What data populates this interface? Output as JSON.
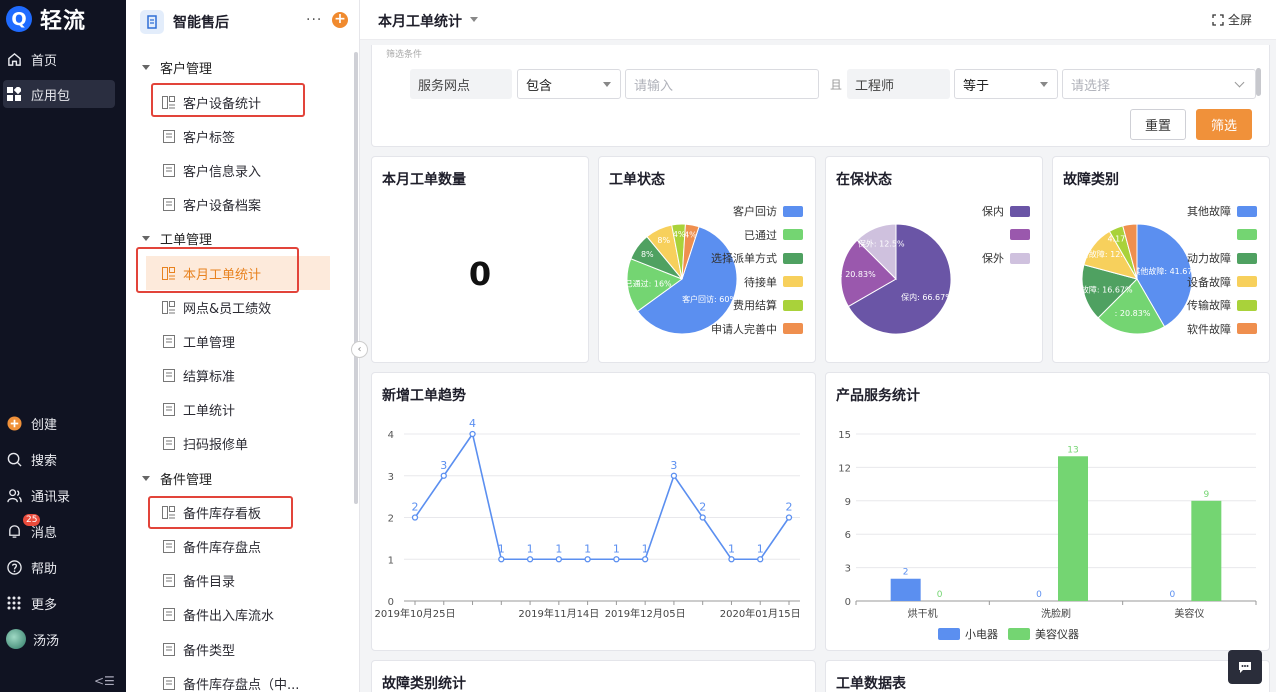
{
  "nav": {
    "brand": "轻流",
    "brand_mark": "Q",
    "top_items": [
      {
        "label": "首页",
        "icon": "home-icon"
      },
      {
        "label": "应用包",
        "icon": "grid-icon"
      }
    ],
    "bottom_items": [
      {
        "label": "创建",
        "icon": "plus-circle-icon"
      },
      {
        "label": "搜索",
        "icon": "search-icon"
      },
      {
        "label": "通讯录",
        "icon": "contacts-icon"
      },
      {
        "label": "消息",
        "icon": "bell-icon",
        "badge": "25"
      },
      {
        "label": "帮助",
        "icon": "help-icon"
      },
      {
        "label": "更多",
        "icon": "dots-grid-icon"
      },
      {
        "label": "汤汤",
        "icon": "avatar"
      }
    ],
    "collapse_glyph": "<☰"
  },
  "sidebar": {
    "app_title": "智能售后",
    "more_glyph": "···",
    "add_glyph": "+",
    "groups": [
      {
        "label": "客户管理",
        "items": [
          "客户设备统计",
          "客户标签",
          "客户信息录入",
          "客户设备档案"
        ]
      },
      {
        "label": "工单管理",
        "items": [
          "本月工单统计",
          "网点&员工绩效",
          "工单管理",
          "结算标准",
          "工单统计",
          "扫码报修单"
        ]
      },
      {
        "label": "备件管理",
        "items": [
          "备件库存看板",
          "备件库存盘点",
          "备件目录",
          "备件出入库流水",
          "备件类型",
          "备件库存盘点（中..."
        ]
      }
    ],
    "active_item": "本月工单统计"
  },
  "topbar": {
    "title": "本月工单统计",
    "fullscreen_label": "全屏"
  },
  "filter": {
    "top_label": "筛选条件",
    "field1_label": "服务网点",
    "op1_value": "包含",
    "input1_placeholder": "请输入",
    "joiner": "且",
    "field2_label": "工程师",
    "op2_value": "等于",
    "select2_placeholder": "请选择",
    "reset_label": "重置",
    "submit_label": "筛选"
  },
  "cards": {
    "count": {
      "title": "本月工单数量",
      "value": "0"
    },
    "status": {
      "title": "工单状态"
    },
    "warranty": {
      "title": "在保状态"
    },
    "fault": {
      "title": "故障类别"
    },
    "trend": {
      "title": "新增工单趋势"
    },
    "product": {
      "title": "产品服务统计"
    },
    "fault_stats": {
      "title": "故障类别统计"
    },
    "table": {
      "title": "工单数据表"
    }
  },
  "chart_data": [
    {
      "id": "status",
      "type": "pie",
      "labels": [
        "客户回访",
        "已通过",
        "选择派单方式",
        "待接单",
        "费用结算",
        "申请人完善中"
      ],
      "values": [
        60,
        16,
        8,
        8,
        4,
        4
      ],
      "slice_labels": [
        "客户回访: 60%",
        "已通过: 16%",
        "8%",
        "8%",
        "4%",
        "4%"
      ],
      "colors": [
        "#5b8ff0",
        "#74d572",
        "#4fa161",
        "#f7d05c",
        "#a9d23a",
        "#ef8f4e"
      ]
    },
    {
      "id": "warranty",
      "type": "pie",
      "labels": [
        "保内",
        "",
        "保外"
      ],
      "values": [
        66.67,
        20.83,
        12.5
      ],
      "slice_labels": [
        "保内: 66.67%",
        ": 20.83%",
        "保外: 12.5%"
      ],
      "colors": [
        "#6a55a6",
        "#9a58ad",
        "#cfc1de"
      ]
    },
    {
      "id": "fault",
      "type": "pie",
      "labels": [
        "其他故障",
        "",
        "动力故障",
        "设备故障",
        "传输故障",
        "软件故障"
      ],
      "values": [
        41.67,
        20.83,
        16.67,
        12.5,
        4.17,
        4.17
      ],
      "slice_labels": [
        "其他故障: 41.67%",
        ": 20.83%",
        "动力故障: 16.67%",
        "设备故障: 12.5%",
        "4.17%",
        ""
      ],
      "colors": [
        "#5b8ff0",
        "#74d572",
        "#4fa161",
        "#f7d05c",
        "#a9d23a",
        "#ef8f4e"
      ]
    },
    {
      "id": "trend",
      "type": "line",
      "x": [
        "2019年10月25日",
        "",
        "",
        "",
        "",
        "2019年11月14日",
        "",
        "",
        "2019年12月05日",
        "",
        "",
        "",
        "2020年01月15日",
        ""
      ],
      "values": [
        2,
        3,
        4,
        1,
        1,
        1,
        1,
        1,
        1,
        3,
        2,
        1,
        1,
        2
      ],
      "ylim": [
        0,
        4
      ],
      "yticks": [
        0,
        1,
        2,
        3,
        4
      ],
      "color": "#5b8ff0"
    },
    {
      "id": "product",
      "type": "bar",
      "categories": [
        "烘干机",
        "洗脸刷",
        "美容仪"
      ],
      "series": [
        {
          "name": "小电器",
          "values": [
            2,
            0,
            0
          ],
          "color": "#5b8ff0"
        },
        {
          "name": "美容仪器",
          "values": [
            0,
            13,
            9
          ],
          "color": "#74d572"
        }
      ],
      "ylim": [
        0,
        15
      ],
      "yticks": [
        0,
        3,
        6,
        9,
        12,
        15
      ]
    }
  ]
}
